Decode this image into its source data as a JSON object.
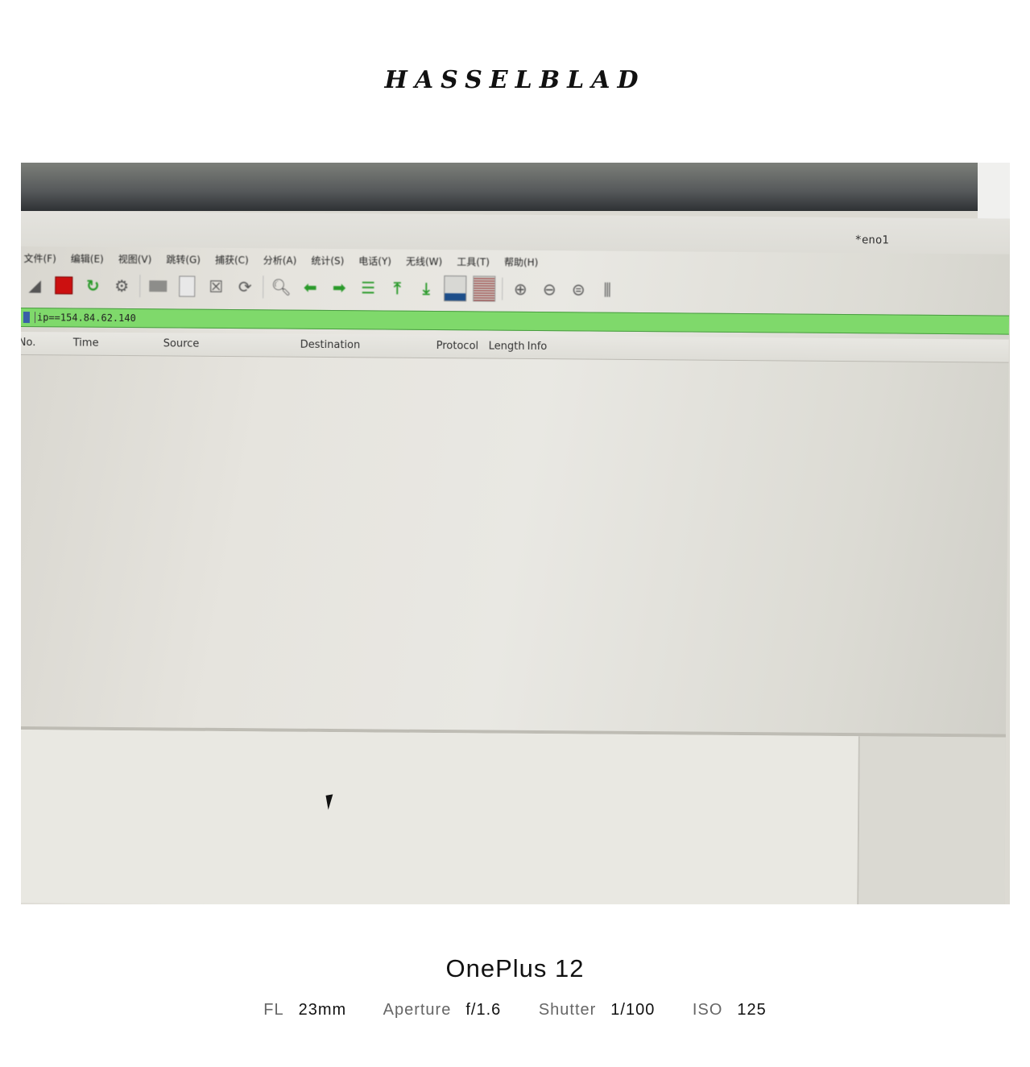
{
  "frame": {
    "brand": "HASSELBLAD",
    "device": "OnePlus 12",
    "exif": [
      {
        "key": "FL",
        "value": "23mm"
      },
      {
        "key": "Aperture",
        "value": "f/1.6"
      },
      {
        "key": "Shutter",
        "value": "1/100"
      },
      {
        "key": "ISO",
        "value": "125"
      }
    ]
  },
  "app": {
    "window_title": "*eno1",
    "menu": [
      "文件(F)",
      "编辑(E)",
      "视图(V)",
      "跳转(G)",
      "捕获(C)",
      "分析(A)",
      "统计(S)",
      "电话(Y)",
      "无线(W)",
      "工具(T)",
      "帮助(H)"
    ],
    "filter": {
      "value": "ip==154.84.62.140"
    },
    "columns": [
      "No.",
      "Time",
      "Source",
      "Destination",
      "Protocol",
      "Length",
      "Info"
    ],
    "colors": {
      "filter_valid": "#7fd96b",
      "stop_capture": "#cc1010"
    }
  }
}
